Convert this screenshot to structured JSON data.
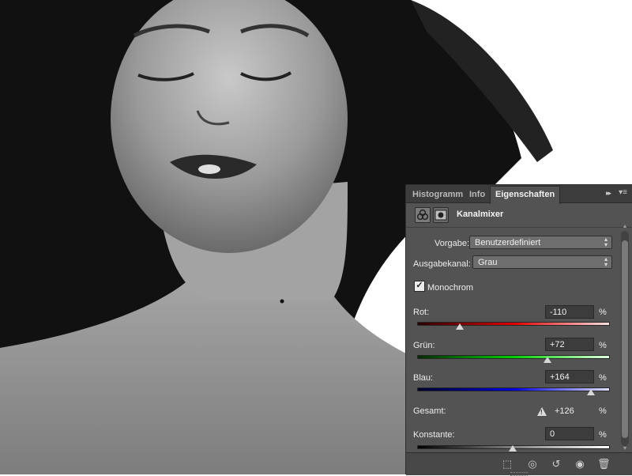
{
  "panel": {
    "tabs": [
      {
        "label": "Histogramm",
        "active": false
      },
      {
        "label": "Info",
        "active": false
      },
      {
        "label": "Eigenschaften",
        "active": true
      }
    ],
    "collapse_glyph": "▸▸",
    "menu_glyph": "▾≡",
    "header": {
      "title": "Kanalmixer",
      "icons": [
        "channel-mixer-icon",
        "mask-icon"
      ]
    },
    "preset": {
      "label": "Vorgabe:",
      "value": "Benutzerdefiniert"
    },
    "output_channel": {
      "label": "Ausgabekanal:",
      "value": "Grau"
    },
    "monochrome": {
      "label": "Monochrom",
      "checked": true,
      "check_glyph": "✓"
    },
    "channels": [
      {
        "label": "Rot:",
        "value": "-110",
        "unit": "%",
        "percent": -110,
        "track_colors": [
          "#2a0000",
          "#e00000",
          "#ffe0e0"
        ]
      },
      {
        "label": "Grün:",
        "value": "+72",
        "unit": "%",
        "percent": 72,
        "track_colors": [
          "#002a00",
          "#00d000",
          "#e0ffe0"
        ]
      },
      {
        "label": "Blau:",
        "value": "+164",
        "unit": "%",
        "percent": 164,
        "track_colors": [
          "#00002a",
          "#0000e0",
          "#e0e0ff"
        ]
      }
    ],
    "total": {
      "label": "Gesamt:",
      "value": "+126",
      "unit": "%",
      "warning_glyph": "!"
    },
    "constant": {
      "label": "Konstante:",
      "value": "0",
      "unit": "%",
      "percent": 0
    },
    "bottom_icons": [
      {
        "name": "clip-to-layer-icon",
        "glyph": "⬚"
      },
      {
        "name": "view-previous-icon",
        "glyph": "◎"
      },
      {
        "name": "reset-icon",
        "glyph": "↺"
      },
      {
        "name": "visibility-icon",
        "glyph": "◉"
      },
      {
        "name": "delete-icon",
        "glyph": "🗑"
      }
    ],
    "scroll_up_glyph": "▲",
    "scroll_down_glyph": "▼"
  }
}
